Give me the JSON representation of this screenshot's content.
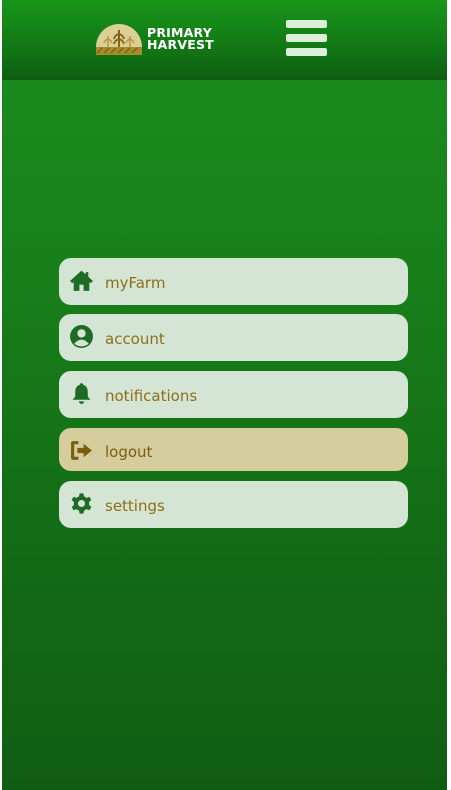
{
  "header": {
    "logo_line1": "PRIMARY",
    "logo_line2": "HARVEST",
    "menu_icon": "hamburger-icon"
  },
  "menu": {
    "items": [
      {
        "label": "myFarm",
        "icon": "home-icon",
        "active": false
      },
      {
        "label": "account",
        "icon": "user-circle-icon",
        "active": false
      },
      {
        "label": "notifications",
        "icon": "bell-icon",
        "active": false
      },
      {
        "label": "logout",
        "icon": "sign-out-icon",
        "active": true
      },
      {
        "label": "settings",
        "icon": "gear-icon",
        "active": false
      }
    ]
  },
  "colors": {
    "background": "#187f1a",
    "header": "#137a16",
    "menu_item_bg": "#d4e5d5",
    "menu_item_active_bg": "#d5cd9e",
    "icon_green": "#1d6b24",
    "icon_gold": "#7a5e10",
    "label_text": "#8e6f16"
  }
}
